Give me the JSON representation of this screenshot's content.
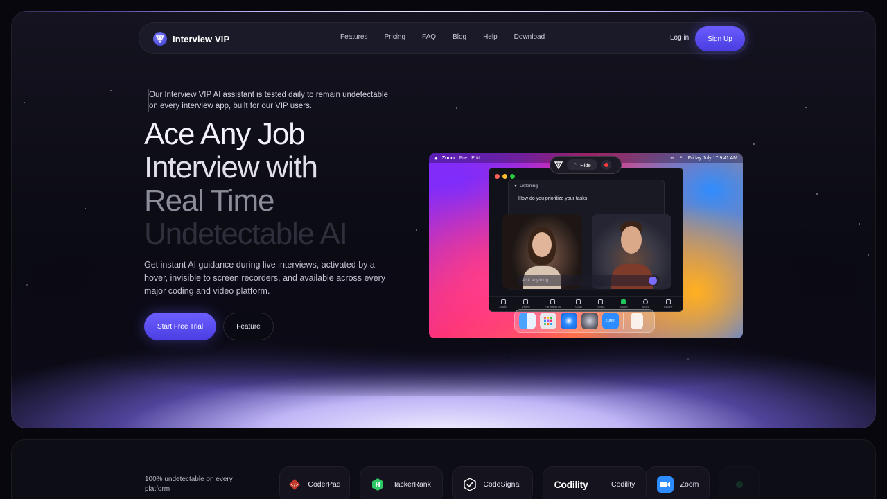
{
  "brand": {
    "name": "Interview VIP"
  },
  "nav": {
    "links": [
      "Features",
      "Pricing",
      "FAQ",
      "Blog",
      "Help",
      "Download"
    ],
    "login": "Log in",
    "signup": "Sign Up"
  },
  "hero": {
    "tagline": "Our Interview VIP AI assistant is tested daily to remain undetectable on every interview app, built for our VIP users.",
    "headline": [
      "Ace Any Job",
      "Interview with",
      "Real Time",
      "Undetectable AI"
    ],
    "description": "Get instant AI guidance during live interviews, activated by a hover, invisible to screen recorders, and available across every major coding and video platform.",
    "cta_primary": "Start Free Trial",
    "cta_secondary": "Feature"
  },
  "mockup": {
    "menubar": {
      "app": "Zoom",
      "items": [
        "File",
        "Edit"
      ],
      "clock": "Friday July 17  9:41 AM"
    },
    "float_bar": {
      "hide": "Hide"
    },
    "assistant": {
      "status": "Listening",
      "question": "How do you prioritize your tasks",
      "input_placeholder": "Ask anything"
    },
    "toolbar": [
      "Audio",
      "Video",
      "Participants",
      "Chat",
      "React",
      "Share",
      "More",
      "Leave"
    ],
    "dock": [
      "Finder",
      "Launchpad",
      "Safari",
      "Settings",
      "zoom",
      "Trash"
    ]
  },
  "platforms": {
    "intro": "100% undetectable on every platform",
    "items": [
      {
        "name": "CoderPad",
        "color": "#e0403a"
      },
      {
        "name": "HackerRank",
        "color": "#2ec866"
      },
      {
        "name": "CodeSignal",
        "color": "#ffffff"
      },
      {
        "name": "Codility",
        "logo_text": "Codility_",
        "color": "#ffffff"
      },
      {
        "name": "Zoom",
        "color": "#2d8cff"
      }
    ]
  },
  "colors": {
    "accent": "#5b4cf0",
    "background": "#07070d"
  }
}
